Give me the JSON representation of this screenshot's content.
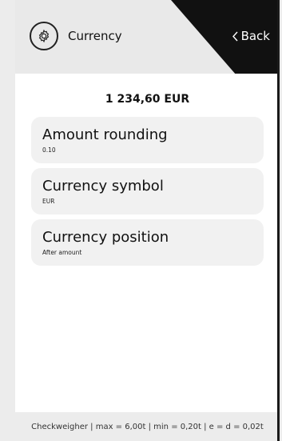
{
  "header": {
    "title": "Currency",
    "settings_icon": "gear-icon",
    "back_label": "Back",
    "back_icon": "chevron-left-icon"
  },
  "amount_display": "1 234,60 EUR",
  "settings": [
    {
      "title": "Amount rounding",
      "value": "0.10"
    },
    {
      "title": "Currency symbol",
      "value": "EUR"
    },
    {
      "title": "Currency position",
      "value": "After amount"
    }
  ],
  "footer": {
    "status": "Checkweigher | max = 6,00t | min = 0,20t | e = d = 0,02t"
  },
  "colors": {
    "header_bg": "#e9e9e9",
    "back_bg": "#111111",
    "content_bg": "#ffffff",
    "card_bg": "#f1f1f1",
    "footer_bg": "#ececec"
  }
}
